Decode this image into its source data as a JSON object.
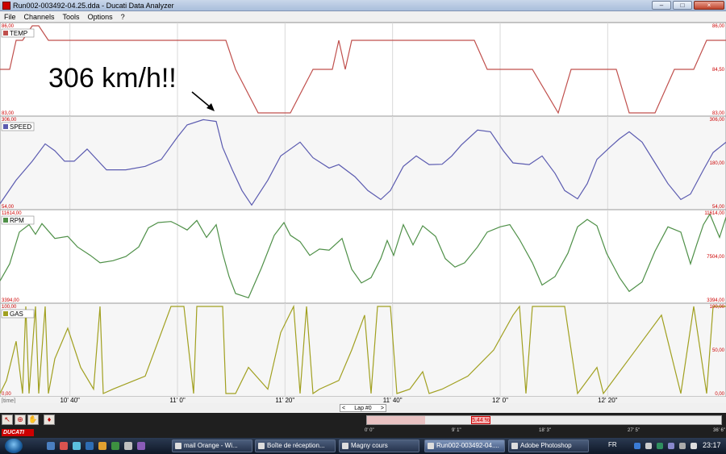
{
  "window": {
    "title": "Run002-003492-04.25.dda - Ducati Data Analyzer"
  },
  "window_buttons": {
    "minimize": "–",
    "maximize": "□",
    "close": "×"
  },
  "menu": [
    "File",
    "Channels",
    "Tools",
    "Options",
    "?"
  ],
  "annotation": {
    "text": "306 km/h!!"
  },
  "colors": {
    "temp": "#c0504d",
    "speed": "#5b5bb0",
    "rpm": "#4f9048",
    "gas": "#a1a020"
  },
  "panels": [
    {
      "id": "temp",
      "label": "TEMP",
      "ytop": "86,00",
      "ymid": "84,50",
      "ybot": "83,00"
    },
    {
      "id": "speed",
      "label": "SPEED",
      "ytop": "306,00",
      "ymid": "180,00",
      "ybot": "54,00"
    },
    {
      "id": "rpm",
      "label": "RPM",
      "ytop": "11614,00",
      "ymid": "7504,00",
      "ybot": "3394,00"
    },
    {
      "id": "gas",
      "label": "GAS",
      "ytop": "100,00",
      "ymid": "50,00",
      "ybot": "0,00"
    }
  ],
  "time_axis": {
    "unit_label": "[time]",
    "ticks": [
      "10' 40\"",
      "11' 0\"",
      "11' 20\"",
      "11' 40\"",
      "12' 0\"",
      "12' 20\""
    ]
  },
  "lap_nav": {
    "prev": "<",
    "label": "Lap #0",
    "next": ">"
  },
  "zoom": {
    "label": "5,44 %",
    "fraction": 0.0544
  },
  "overview_ticks": [
    "0' 0\"",
    "9' 1\"",
    "18' 3\"",
    "27' 5\"",
    "36' 6\""
  ],
  "logo_text": "DUCATI",
  "taskbar": {
    "items": [
      {
        "label": "mail Orange - Wi...",
        "active": false
      },
      {
        "label": "Boîte de réception...",
        "active": false
      },
      {
        "label": "Magny cours",
        "active": false
      },
      {
        "label": "Run002-003492-04....",
        "active": true
      },
      {
        "label": "Adobe Photoshop",
        "active": false
      }
    ],
    "lang": "FR",
    "clock": "23:17"
  },
  "chart_data": [
    {
      "type": "line",
      "title": "TEMP",
      "x_range": [
        10.45,
        12.7
      ],
      "ylim": [
        83.0,
        86.0
      ],
      "x": [
        10.45,
        10.48,
        10.5,
        10.52,
        10.55,
        10.57,
        10.6,
        10.62,
        10.64,
        10.68,
        10.75,
        10.85,
        10.95,
        11.05,
        11.15,
        11.18,
        11.25,
        11.3,
        11.35,
        11.42,
        11.48,
        11.5,
        11.52,
        11.54,
        11.58,
        11.63,
        11.7,
        11.72,
        11.78,
        11.85,
        11.92,
        11.96,
        12.02,
        12.06,
        12.1,
        12.18,
        12.22,
        12.28,
        12.36,
        12.4,
        12.48,
        12.54,
        12.6,
        12.64,
        12.7
      ],
      "y": [
        84.5,
        84.5,
        85.5,
        85.5,
        86.0,
        86.0,
        85.5,
        85.5,
        85.5,
        85.5,
        85.5,
        85.5,
        85.5,
        85.5,
        85.5,
        84.5,
        83.0,
        83.0,
        83.0,
        84.5,
        84.5,
        85.5,
        84.5,
        85.5,
        85.5,
        85.5,
        85.5,
        85.5,
        85.5,
        85.5,
        85.5,
        84.5,
        84.5,
        84.5,
        84.5,
        83.0,
        84.5,
        84.5,
        84.5,
        83.0,
        83.0,
        84.5,
        84.5,
        85.5,
        85.5
      ]
    },
    {
      "type": "line",
      "title": "SPEED",
      "x_range": [
        10.45,
        12.7
      ],
      "ylim": [
        54.0,
        306.0
      ],
      "x": [
        10.45,
        10.5,
        10.55,
        10.59,
        10.62,
        10.65,
        10.68,
        10.72,
        10.78,
        10.84,
        10.9,
        10.95,
        11.0,
        11.03,
        11.08,
        11.12,
        11.14,
        11.17,
        11.2,
        11.23,
        11.28,
        11.32,
        11.38,
        11.42,
        11.47,
        11.5,
        11.55,
        11.59,
        11.63,
        11.66,
        11.7,
        11.74,
        11.78,
        11.82,
        11.85,
        11.88,
        11.93,
        11.97,
        12.01,
        12.04,
        12.09,
        12.13,
        12.17,
        12.2,
        12.24,
        12.27,
        12.3,
        12.34,
        12.37,
        12.4,
        12.44,
        12.48,
        12.52,
        12.56,
        12.59,
        12.63,
        12.66,
        12.7
      ],
      "y": [
        62,
        130,
        185,
        235,
        215,
        185,
        185,
        220,
        160,
        160,
        170,
        190,
        255,
        290,
        305,
        300,
        225,
        160,
        100,
        58,
        130,
        200,
        240,
        195,
        165,
        175,
        140,
        100,
        74,
        100,
        170,
        200,
        175,
        176,
        200,
        232,
        275,
        270,
        215,
        180,
        175,
        200,
        150,
        100,
        76,
        120,
        190,
        225,
        250,
        270,
        240,
        180,
        120,
        74,
        90,
        160,
        210,
        240
      ]
    },
    {
      "type": "line",
      "title": "RPM",
      "x_range": [
        10.45,
        12.7
      ],
      "ylim": [
        3394.0,
        11614.0
      ],
      "x": [
        10.45,
        10.48,
        10.51,
        10.54,
        10.56,
        10.58,
        10.62,
        10.66,
        10.69,
        10.73,
        10.76,
        10.8,
        10.84,
        10.88,
        10.91,
        10.94,
        10.98,
        11.0,
        11.03,
        11.06,
        11.09,
        11.12,
        11.14,
        11.16,
        11.18,
        11.22,
        11.26,
        11.3,
        11.33,
        11.35,
        11.38,
        11.41,
        11.44,
        11.47,
        11.51,
        11.54,
        11.57,
        11.6,
        11.63,
        11.65,
        11.67,
        11.7,
        11.73,
        11.76,
        11.8,
        11.83,
        11.86,
        11.89,
        11.93,
        11.96,
        12.0,
        12.03,
        12.06,
        12.1,
        12.13,
        12.17,
        12.21,
        12.24,
        12.27,
        12.3,
        12.33,
        12.37,
        12.4,
        12.44,
        12.48,
        12.52,
        12.56,
        12.59,
        12.61,
        12.63,
        12.65,
        12.68,
        12.7
      ],
      "y": [
        5200,
        6800,
        9800,
        10500,
        9600,
        10600,
        9200,
        9400,
        8400,
        7600,
        6900,
        7100,
        7500,
        8400,
        10200,
        10700,
        10800,
        10500,
        10000,
        10900,
        9300,
        10500,
        7800,
        5600,
        4000,
        3600,
        6400,
        9500,
        10700,
        9500,
        8900,
        7600,
        8200,
        8100,
        9200,
        6300,
        5000,
        5500,
        7300,
        9000,
        7600,
        10500,
        8600,
        10400,
        9400,
        7300,
        6500,
        6900,
        8400,
        9800,
        10300,
        10500,
        9100,
        6900,
        4800,
        5600,
        7800,
        10300,
        11000,
        10400,
        7800,
        5500,
        4200,
        5100,
        8000,
        10300,
        9800,
        6800,
        8700,
        10500,
        11500,
        9300,
        11200
      ]
    },
    {
      "type": "line",
      "title": "GAS",
      "x_range": [
        10.45,
        12.7
      ],
      "ylim": [
        0.0,
        100.0
      ],
      "x": [
        10.45,
        10.47,
        10.5,
        10.52,
        10.53,
        10.54,
        10.56,
        10.57,
        10.59,
        10.6,
        10.62,
        10.66,
        10.7,
        10.74,
        10.76,
        10.77,
        10.8,
        10.9,
        10.98,
        11.0,
        11.02,
        11.05,
        11.06,
        11.1,
        11.14,
        11.15,
        11.18,
        11.22,
        11.28,
        11.32,
        11.36,
        11.38,
        11.4,
        11.42,
        11.44,
        11.5,
        11.54,
        11.58,
        11.6,
        11.62,
        11.66,
        11.68,
        11.72,
        11.76,
        11.78,
        11.82,
        11.9,
        11.98,
        12.04,
        12.06,
        12.08,
        12.1,
        12.16,
        12.2,
        12.24,
        12.3,
        12.32,
        12.36,
        12.4,
        12.44,
        12.5,
        12.56,
        12.6,
        12.64,
        12.66,
        12.7
      ],
      "y": [
        0,
        15,
        60,
        0,
        100,
        0,
        100,
        0,
        100,
        0,
        40,
        75,
        30,
        5,
        100,
        0,
        5,
        20,
        100,
        100,
        100,
        0,
        100,
        100,
        100,
        0,
        0,
        30,
        5,
        70,
        100,
        0,
        100,
        0,
        5,
        15,
        50,
        90,
        0,
        100,
        100,
        0,
        5,
        25,
        0,
        5,
        20,
        50,
        90,
        100,
        0,
        100,
        100,
        100,
        0,
        30,
        0,
        20,
        40,
        60,
        90,
        0,
        100,
        0,
        100,
        100
      ]
    }
  ]
}
